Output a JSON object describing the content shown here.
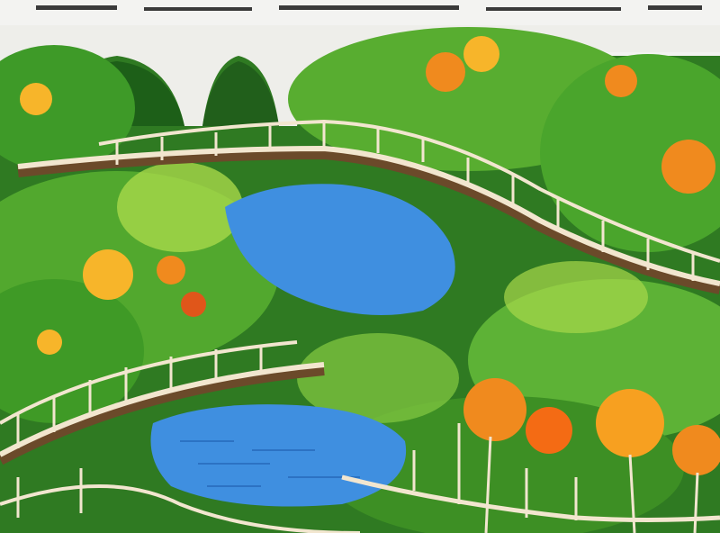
{
  "image": {
    "subject": "stylized-painted-landscape",
    "elements": [
      "stone-viaduct-icon",
      "wooden-footbridge-icon",
      "blue-pond-icon",
      "autumn-tree-icon",
      "green-foliage-icon"
    ],
    "palette": {
      "sky_white": "#f3f3f1",
      "viaduct": "#eeeeea",
      "foliage_dark": "#1f6a1a",
      "foliage_mid": "#4aa52c",
      "foliage_light": "#a8d84a",
      "autumn_orange": "#f08a1e",
      "autumn_yellow": "#f7b52a",
      "pond_blue": "#3f8fe0",
      "pond_deep": "#2466b8",
      "bridge_rail": "#f2e6cf",
      "bridge_shadow": "#6b4a2a"
    }
  }
}
